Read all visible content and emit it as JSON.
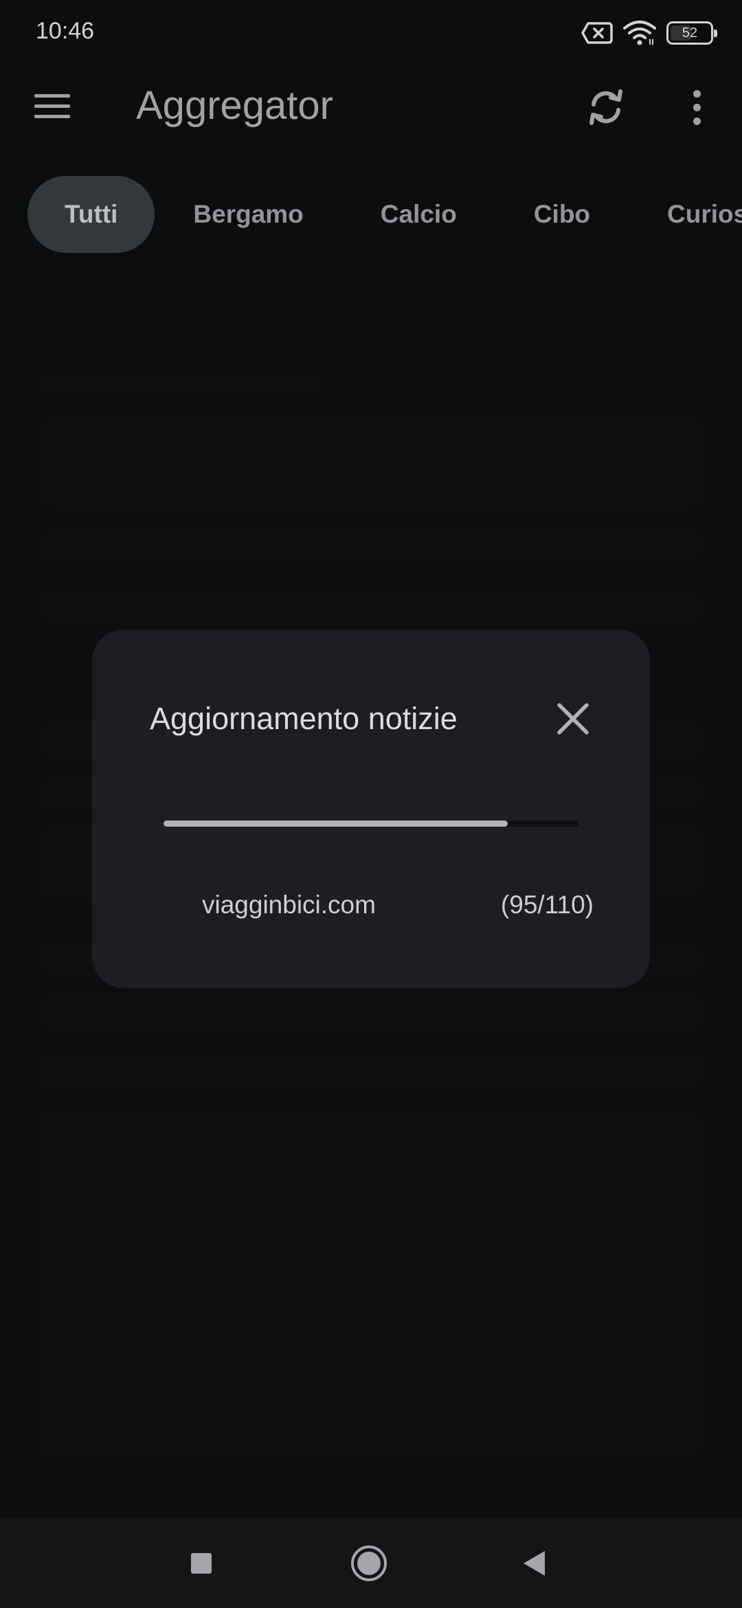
{
  "status_bar": {
    "time": "10:46",
    "battery_level": "52",
    "icons": [
      "sim-x-icon",
      "wifi-icon",
      "battery-icon"
    ]
  },
  "app_bar": {
    "title": "Aggregator",
    "icons": [
      "menu-icon",
      "refresh-icon",
      "more-vert-icon"
    ]
  },
  "chips": [
    {
      "label": "Tutti",
      "selected": true
    },
    {
      "label": "Bergamo",
      "selected": false
    },
    {
      "label": "Calcio",
      "selected": false
    },
    {
      "label": "Cibo",
      "selected": false
    },
    {
      "label": "Curios",
      "selected": false
    }
  ],
  "dialog": {
    "title": "Aggiornamento notizie",
    "progress_current": 95,
    "progress_total": 110,
    "progress_fraction": 0.83,
    "source": "viagginbici.com",
    "count_text": "(95/110)"
  },
  "nav_bar": {
    "icons": [
      "recents-icon",
      "home-icon",
      "back-icon"
    ]
  },
  "colors": {
    "background": "#0e0f11",
    "dialog_bg": "#1e1e22",
    "chip_selected_bg": "#3b4144",
    "progress_fill": "#b3b3b6"
  }
}
